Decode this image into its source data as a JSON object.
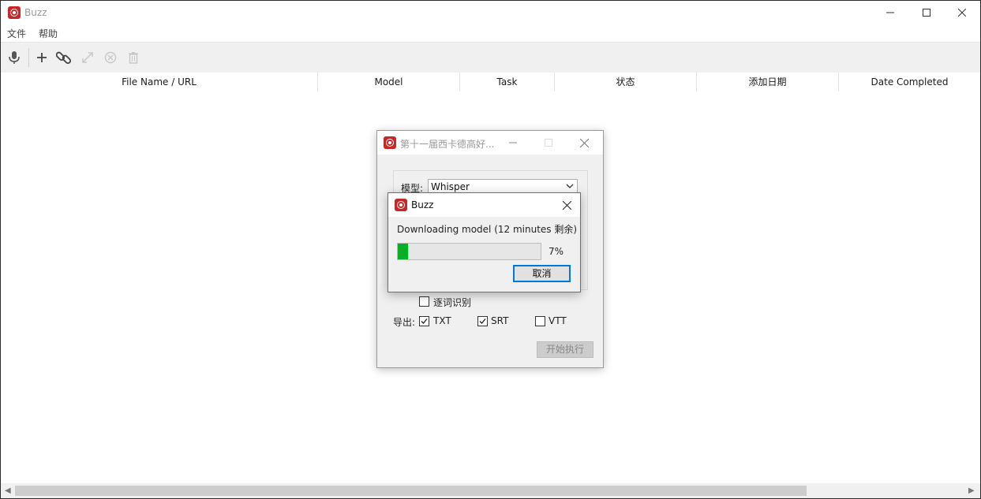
{
  "window": {
    "title": "Buzz"
  },
  "menu": [
    "文件",
    "帮助"
  ],
  "toolbar": {
    "icons": [
      "microphone-icon",
      "plus-icon",
      "link-icon",
      "expand-icon",
      "cancel-icon",
      "trash-icon"
    ]
  },
  "table": {
    "columns": [
      "File Name / URL",
      "Model",
      "Task",
      "状态",
      "添加日期",
      "Date Completed"
    ]
  },
  "transcriber_dialog": {
    "title": "第十一届西卡德高好...",
    "model_label": "模型:",
    "model_value": "Whisper",
    "word_level_label": "逐词识别",
    "word_level_checked": false,
    "export_label": "导出:",
    "export_options": [
      {
        "label": "TXT",
        "checked": true
      },
      {
        "label": "SRT",
        "checked": true
      },
      {
        "label": "VTT",
        "checked": false
      }
    ],
    "start_label": "开始执行"
  },
  "download_dialog": {
    "title": "Buzz",
    "message": "Downloading model (12 minutes 剩余)",
    "progress": 0.07,
    "progress_text": "7%",
    "cancel_label": "取消",
    "progress_color": "#06b025"
  },
  "colors": {
    "accent": "#0078d7",
    "app_icon": "#c62828"
  }
}
